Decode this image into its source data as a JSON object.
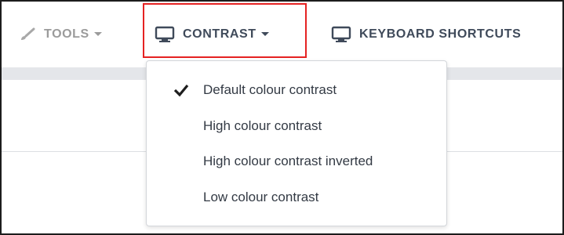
{
  "toolbar": {
    "tools_label": "TOOLS",
    "contrast_label": "CONTRAST",
    "shortcuts_label": "KEYBOARD SHORTCUTS"
  },
  "contrast_menu": {
    "items": [
      {
        "label": "Default colour contrast",
        "checked": true
      },
      {
        "label": "High colour contrast",
        "checked": false
      },
      {
        "label": "High colour contrast inverted",
        "checked": false
      },
      {
        "label": "Low colour contrast",
        "checked": false
      }
    ]
  },
  "icons": {
    "tools": "brush-icon",
    "contrast": "monitor-icon",
    "shortcuts": "monitor-icon",
    "check": "checkmark-icon"
  },
  "colors": {
    "highlight": "#e52222",
    "text_dark": "#3f4a5a",
    "text_disabled": "#9b9b9b",
    "strip": "#e4e6ea"
  }
}
